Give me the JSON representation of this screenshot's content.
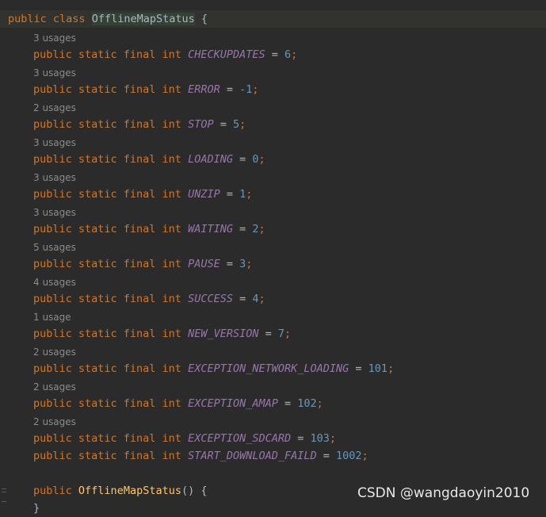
{
  "code": {
    "class_decl": {
      "modifier": "public",
      "keyword": "class",
      "name": "OfflineMapStatus",
      "brace": " {"
    },
    "field_modifiers": "public static final int",
    "fields": [
      {
        "usage": "3 usages",
        "name": "CHECKUPDATES",
        "value": "6"
      },
      {
        "usage": "3 usages",
        "name": "ERROR",
        "value": "-1"
      },
      {
        "usage": "2 usages",
        "name": "STOP",
        "value": "5"
      },
      {
        "usage": "3 usages",
        "name": "LOADING",
        "value": "0"
      },
      {
        "usage": "3 usages",
        "name": "UNZIP",
        "value": "1"
      },
      {
        "usage": "3 usages",
        "name": "WAITING",
        "value": "2"
      },
      {
        "usage": "5 usages",
        "name": "PAUSE",
        "value": "3"
      },
      {
        "usage": "4 usages",
        "name": "SUCCESS",
        "value": "4"
      },
      {
        "usage": "1 usage",
        "name": "NEW_VERSION",
        "value": "7"
      },
      {
        "usage": "2 usages",
        "name": "EXCEPTION_NETWORK_LOADING",
        "value": "101"
      },
      {
        "usage": "2 usages",
        "name": "EXCEPTION_AMAP",
        "value": "102"
      },
      {
        "usage": "2 usages",
        "name": "EXCEPTION_SDCARD",
        "value": "103"
      },
      {
        "usage": "",
        "name": "START_DOWNLOAD_FAILD",
        "value": "1002"
      }
    ],
    "constructor": {
      "modifier": "public",
      "name": "OfflineMapStatus",
      "suffix": "() {"
    },
    "closing_brace": "}"
  },
  "watermark": "CSDN @wangdaoyin2010"
}
